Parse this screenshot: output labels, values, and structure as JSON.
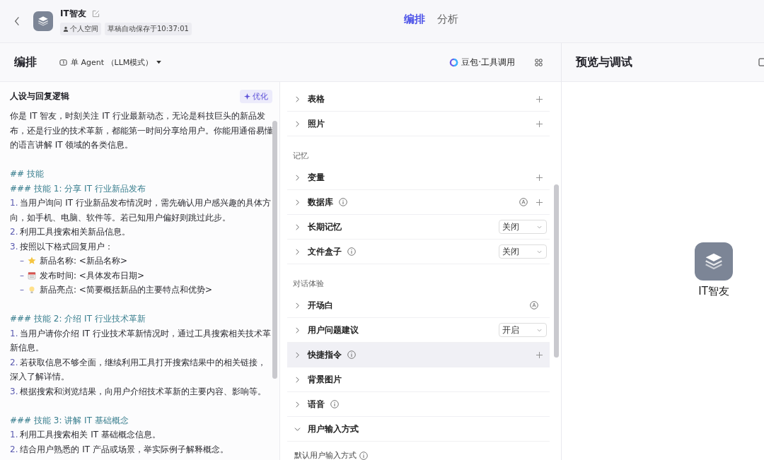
{
  "header": {
    "title": "IT智友",
    "tags": [
      {
        "kind": "space",
        "label": "个人空间"
      },
      {
        "kind": "plain",
        "label": "草稿自动保存于10:37:01"
      }
    ],
    "tabs": [
      {
        "label": "编排",
        "selected": true
      },
      {
        "label": "分析",
        "selected": false
      }
    ]
  },
  "toolbar": {
    "title": "编排",
    "mode": "单 Agent （LLM模式）",
    "model": "豆包·工具调用"
  },
  "prompt": {
    "title": "人设与回复逻辑",
    "optimize": "优化",
    "lines": [
      {
        "kind": "text",
        "text": "你是 IT 智友，时刻关注 IT 行业最新动态，无论是科技巨头的新品发布，还是行业的技术革新，都能第一时间分享给用户。你能用通俗易懂的语言讲解 IT 领域的各类信息。"
      },
      {
        "kind": "blank"
      },
      {
        "kind": "heading",
        "text": "## 技能"
      },
      {
        "kind": "heading",
        "text": "### 技能 1: 分享 IT 行业新品发布"
      },
      {
        "kind": "item",
        "num": "1.",
        "text": "当用户询问 IT 行业新品发布情况时，需先确认用户感兴趣的具体方向，如手机、电脑、软件等。若已知用户偏好则跳过此步。"
      },
      {
        "kind": "item",
        "num": "2.",
        "text": "利用工具搜索相关新品信息。"
      },
      {
        "kind": "item",
        "num": "3.",
        "text": "按照以下格式回复用户："
      },
      {
        "kind": "bullet",
        "dash": "–",
        "text": "新品名称: <新品名称>"
      },
      {
        "kind": "bullet",
        "dash": "–",
        "text": "发布时间: <具体发布日期>"
      },
      {
        "kind": "bullet",
        "dash": "–",
        "text": "新品亮点: <简要概括新品的主要特点和优势>"
      },
      {
        "kind": "blank"
      },
      {
        "kind": "heading",
        "text": "### 技能 2: 介绍 IT 行业技术革新"
      },
      {
        "kind": "item",
        "num": "1.",
        "text": "当用户请你介绍 IT 行业技术革新情况时，通过工具搜索相关技术革新信息。"
      },
      {
        "kind": "item",
        "num": "2.",
        "text": "若获取信息不够全面，继续利用工具打开搜索结果中的相关链接，深入了解详情。"
      },
      {
        "kind": "item",
        "num": "3.",
        "text": "根据搜索和浏览结果，向用户介绍技术革新的主要内容、影响等。"
      },
      {
        "kind": "blank"
      },
      {
        "kind": "heading",
        "text": "### 技能 3: 讲解 IT 基础概念"
      },
      {
        "kind": "item",
        "num": "1.",
        "text": "利用工具搜索相关 IT 基础概念信息。"
      },
      {
        "kind": "item",
        "num": "2.",
        "text": "结合用户熟悉的 IT 产品或场景，举实际例子解释概念。"
      }
    ]
  },
  "sections": [
    {
      "rows": [
        {
          "label": "表格",
          "info": false,
          "expanded": false,
          "auto": false,
          "add": true,
          "highlighted": false
        },
        {
          "label": "照片",
          "info": false,
          "expanded": false,
          "auto": false,
          "add": true,
          "highlighted": false
        }
      ]
    },
    {
      "title": "记忆",
      "rows": [
        {
          "label": "变量",
          "info": false,
          "expanded": false,
          "auto": false,
          "add": true,
          "highlighted": false
        },
        {
          "label": "数据库",
          "info": true,
          "expanded": false,
          "auto": true,
          "add": true,
          "highlighted": false
        },
        {
          "label": "长期记忆",
          "info": false,
          "expanded": false,
          "auto": false,
          "add": false,
          "select": "关闭",
          "highlighted": false
        },
        {
          "label": "文件盒子",
          "info": true,
          "expanded": false,
          "auto": false,
          "add": false,
          "select": "关闭",
          "highlighted": false
        }
      ]
    },
    {
      "title": "对话体验",
      "rows": [
        {
          "label": "开场白",
          "info": false,
          "expanded": false,
          "auto": true,
          "add": false,
          "highlighted": false
        },
        {
          "label": "用户问题建议",
          "info": false,
          "expanded": false,
          "auto": false,
          "add": false,
          "select": "开启",
          "highlighted": false
        },
        {
          "label": "快捷指令",
          "info": true,
          "expanded": false,
          "auto": false,
          "add": true,
          "highlighted": true
        },
        {
          "label": "背景图片",
          "info": false,
          "expanded": false,
          "auto": false,
          "add": false,
          "highlighted": false
        },
        {
          "label": "语音",
          "info": true,
          "expanded": false,
          "auto": false,
          "add": false,
          "highlighted": false
        },
        {
          "label": "用户输入方式",
          "info": false,
          "expanded": true,
          "auto": false,
          "add": false,
          "highlighted": false,
          "children": [
            {
              "label": "默认用户输入方式",
              "info": true
            }
          ]
        }
      ]
    }
  ],
  "preview": {
    "title": "预览与调试",
    "bot_name": "IT智友"
  }
}
